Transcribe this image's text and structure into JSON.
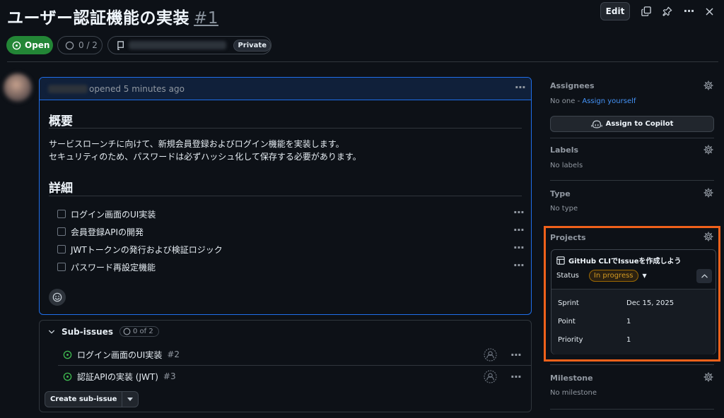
{
  "header": {
    "title": "ユーザー認証機能の実装",
    "number": "#1",
    "edit_label": "Edit",
    "state_label": "Open",
    "tasks_progress": "0 / 2",
    "repo_visibility": "Private"
  },
  "comment": {
    "opened_text": "opened 5 minutes ago",
    "heading_overview": "概要",
    "overview_line1": "サービスローンチに向けて、新規会員登録およびログイン機能を実装します。",
    "overview_line2": "セキュリティのため、パスワードは必ずハッシュ化して保存する必要があります。",
    "heading_details": "詳細",
    "tasks": [
      {
        "label": "ログイン画面のUI実装",
        "checked": false
      },
      {
        "label": "会員登録APIの開発",
        "checked": false
      },
      {
        "label": "JWTトークンの発行および検証ロジック",
        "checked": false
      },
      {
        "label": "パスワード再設定機能",
        "checked": false
      }
    ]
  },
  "sub_issues": {
    "title": "Sub-issues",
    "count": "0 of 2",
    "items": [
      {
        "title": "ログイン画面のUI実装",
        "ref": "#2"
      },
      {
        "title": "認証APIの実装 (JWT)",
        "ref": "#3"
      }
    ],
    "create_label": "Create sub-issue"
  },
  "sidebar": {
    "assignees_title": "Assignees",
    "assignees_none": "No one - ",
    "assign_yourself": "Assign yourself",
    "copilot_label": "Assign to Copilot",
    "labels_title": "Labels",
    "labels_value": "No labels",
    "type_title": "Type",
    "type_value": "No type",
    "projects_title": "Projects",
    "milestone_title": "Milestone",
    "milestone_value": "No milestone"
  },
  "project": {
    "name": "GitHub CLIでIssueを作成しよう",
    "status_label": "Status",
    "status_value": "In progress",
    "fields": [
      {
        "key": "Sprint",
        "value": "Dec 15, 2025"
      },
      {
        "key": "Point",
        "value": "1"
      },
      {
        "key": "Priority",
        "value": "1"
      }
    ]
  },
  "colors": {
    "open_green": "#238636",
    "accent_blue": "#1f6feb",
    "highlight_orange": "#f0611b",
    "status_yellow": "#d29922"
  }
}
